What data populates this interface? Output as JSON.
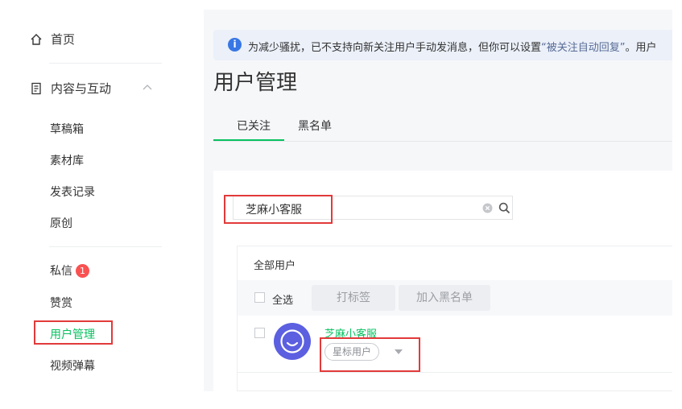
{
  "sidebar": {
    "home": "首页",
    "content": "内容与互动",
    "items": [
      {
        "label": "草稿箱"
      },
      {
        "label": "素材库"
      },
      {
        "label": "发表记录"
      },
      {
        "label": "原创"
      },
      {
        "label": "私信",
        "badge": "1"
      },
      {
        "label": "赞赏"
      },
      {
        "label": "用户管理"
      },
      {
        "label": "视频弹幕"
      }
    ]
  },
  "notice": {
    "text_before": "为减少骚扰，已不支持向新关注用户手动发消息，但你可以设置",
    "link": "“被关注自动回复”",
    "text_after": "。用户"
  },
  "page_title": "用户管理",
  "tabs": [
    {
      "label": "已关注"
    },
    {
      "label": "黑名单"
    }
  ],
  "search": {
    "value": "芝麻小客服"
  },
  "table": {
    "group": "全部用户",
    "select_all": "全选",
    "tag_button": "打标签",
    "blacklist_button": "加入黑名单",
    "users": [
      {
        "name": "芝麻小客服",
        "tag": "星标用户"
      }
    ]
  },
  "colors": {
    "accent": "#07c160",
    "badge": "#fa5151",
    "highlight": "#e23a3a",
    "info": "#3877e4"
  }
}
